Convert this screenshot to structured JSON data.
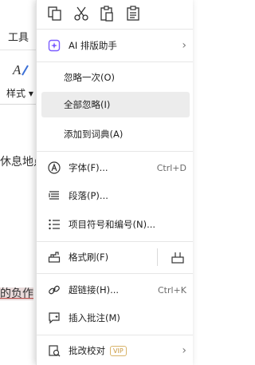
{
  "background": {
    "ribbon_tab": "工具",
    "style_label": "样式",
    "doc_text_1": "休息地点",
    "doc_text_2": "的负作"
  },
  "quick_bar": {
    "icons": [
      "copy-icon",
      "cut-icon",
      "paste-icon",
      "paste-special-icon"
    ]
  },
  "menu": {
    "ai_layout": "AI 排版助手",
    "ignore_once": "忽略一次(O)",
    "ignore_all": "全部忽略(I)",
    "add_to_dictionary": "添加到词典(A)",
    "font": "字体(F)...",
    "font_shortcut": "Ctrl+D",
    "paragraph": "段落(P)...",
    "bullets_numbering": "项目符号和编号(N)...",
    "format_painter": "格式刷(F)",
    "hyperlink": "超链接(H)...",
    "hyperlink_shortcut": "Ctrl+K",
    "insert_comment": "插入批注(M)",
    "proofreading": "批改校对",
    "vip_badge": "VIP"
  },
  "colors": {
    "accent": "#7b5cff",
    "vip": "#c8973c",
    "hover": "#ececec"
  }
}
